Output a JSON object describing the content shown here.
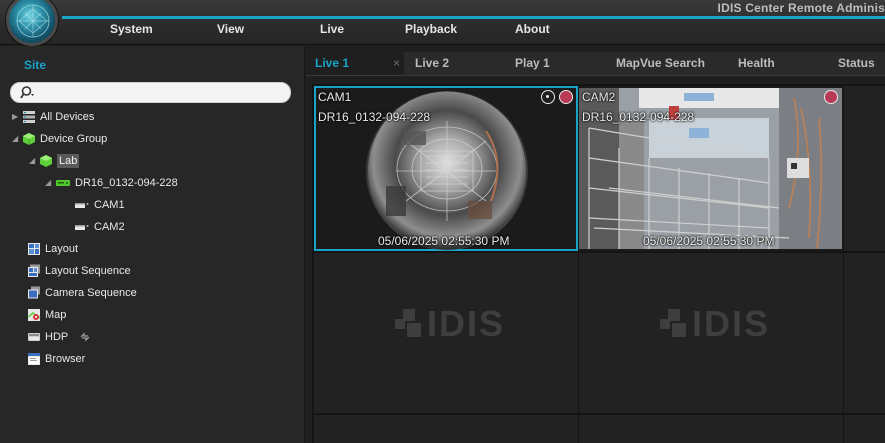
{
  "app": {
    "title": "IDIS Center Remote Adminis"
  },
  "menu": [
    "System",
    "View",
    "Live",
    "Playback",
    "About"
  ],
  "left_panel": {
    "tab_label": "Site",
    "search": {
      "value": "",
      "placeholder": ""
    },
    "tree": [
      {
        "label": "All Devices",
        "icon": "all-devices-icon"
      },
      {
        "label": "Device Group",
        "icon": "device-group-icon"
      },
      {
        "label": "Lab",
        "icon": "group-icon"
      },
      {
        "label": "DR16_0132-094-228",
        "icon": "recorder-icon"
      },
      {
        "label": "CAM1",
        "icon": "camera-icon"
      },
      {
        "label": "CAM2",
        "icon": "camera-icon"
      },
      {
        "label": "Layout",
        "icon": "layout-icon"
      },
      {
        "label": "Layout Sequence",
        "icon": "layout-sequence-icon"
      },
      {
        "label": "Camera Sequence",
        "icon": "camera-sequence-icon"
      },
      {
        "label": "Map",
        "icon": "map-icon"
      },
      {
        "label": "HDP",
        "icon": "hdp-icon"
      },
      {
        "label": "Browser",
        "icon": "browser-icon"
      }
    ]
  },
  "tabs": [
    {
      "label": "Live 1",
      "active": true,
      "close": "×"
    },
    {
      "label": "Live 2",
      "active": false
    },
    {
      "label": "Play 1",
      "active": false
    },
    {
      "label": "MapVue Search",
      "active": false
    },
    {
      "label": "Health",
      "active": false
    },
    {
      "label": "Status",
      "active": false
    }
  ],
  "cameras": [
    {
      "name": "CAM1",
      "device": "DR16_0132-094-228",
      "timestamp": "05/06/2025 02:55:30 PM",
      "selected": true
    },
    {
      "name": "CAM2",
      "device": "DR16_0132-094-228",
      "timestamp": "05/06/2025 02:55:30 PM",
      "selected": false
    }
  ],
  "empty_cell_logo": "IDIS",
  "colors": {
    "accent": "#1aa3c8",
    "record": "#b83a55"
  }
}
